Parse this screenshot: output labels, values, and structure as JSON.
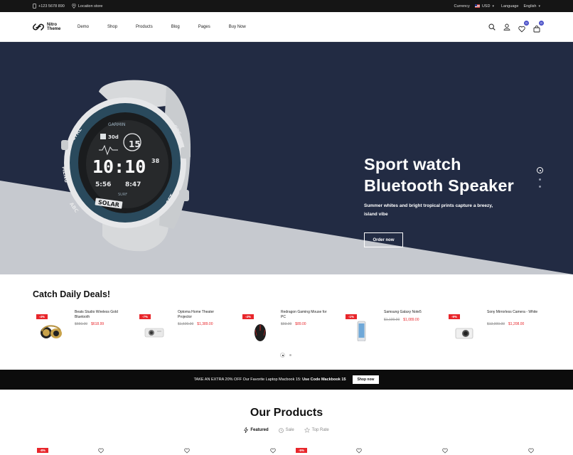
{
  "topbar": {
    "phone": "+123 5678 890",
    "location": "Location store",
    "currency_label": "Currency",
    "currency_value": "USD",
    "language_label": "Language",
    "language_value": "English"
  },
  "header": {
    "logo_line1": "Nitro",
    "logo_line2": "Theme",
    "nav": [
      "Demo",
      "Shop",
      "Products",
      "Blog",
      "Pages",
      "Buy Now"
    ],
    "wishlist_count": "0",
    "cart_count": "0"
  },
  "hero": {
    "title_line1": "Sport watch",
    "title_line2": "Bluetooth Speaker",
    "subtitle": "Summer whites and bright tropical prints capture a breezy, island vibe",
    "button": "Order now",
    "watch": {
      "brand": "GARMIN",
      "bezel_left": "CTRL",
      "bezel_menu": "MENU",
      "bezel_abc": "ABC",
      "bezel_gps": "GPS",
      "bezel_set": "SET",
      "temp": "30d",
      "date": "15",
      "time": "10:10",
      "seconds": "38",
      "sub_left": "5:56",
      "sub_right": "8:47",
      "mode": "SURF",
      "model": "SOLAR"
    },
    "slides": 3,
    "active_slide": 1
  },
  "deals": {
    "title": "Catch Daily Deals!",
    "items": [
      {
        "badge": "-4%",
        "name": "Beats Studio Wireless Gold Bluetooth",
        "old": "$650.00",
        "new": "$618.99",
        "icon": "headphones-icon"
      },
      {
        "badge": "-7%",
        "name": "Optoma Home Theater Projector",
        "old": "$1,500.00",
        "new": "$1,389.00",
        "icon": "projector-icon"
      },
      {
        "badge": "-4%",
        "name": "Redragon Gaming Mouse for PC",
        "old": "$93.00",
        "new": "$89.00",
        "icon": "mouse-icon"
      },
      {
        "badge": "-1%",
        "name": "Samsung Galaxy Note5",
        "old": "$1,100.00",
        "new": "$1,089.00",
        "icon": "phone-icon"
      },
      {
        "badge": "-9%",
        "name": "Sony Mirrorless Camera - White",
        "old": "$13,000.00",
        "new": "$1,208.00",
        "icon": "camera-icon"
      }
    ]
  },
  "promo": {
    "text1": "TAKE AN EXTRA 20% OFF",
    "text2": "Our Favorite Laptop Macbook 15:",
    "text3": "Use Code Mackbook 15",
    "button": "Shop now"
  },
  "products": {
    "title": "Our Products",
    "tabs": [
      "Featured",
      "Sale",
      "Top Rate"
    ],
    "card_badges": [
      "-8%",
      "-5%"
    ]
  },
  "colors": {
    "hero_bg": "#222b43",
    "accent_red": "#e8262b",
    "badge_purple": "#4a50c8"
  }
}
